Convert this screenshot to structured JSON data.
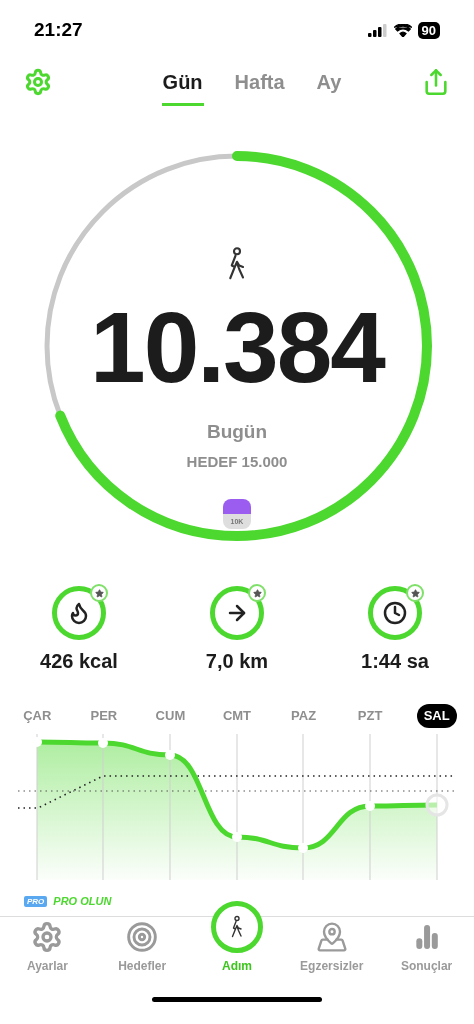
{
  "status_bar": {
    "time": "21:27",
    "battery": "90"
  },
  "tabs": [
    {
      "label": "Gün",
      "selected": true
    },
    {
      "label": "Hafta",
      "selected": false
    },
    {
      "label": "Ay",
      "selected": false
    }
  ],
  "ring": {
    "level": 0.69,
    "steps": "10.384",
    "day": "Bugün",
    "goal": "HEDEF 15.000",
    "badge": "10K"
  },
  "stats": [
    {
      "kind": "calories",
      "value": "426 kcal"
    },
    {
      "kind": "distance",
      "value": "7,0 km"
    },
    {
      "kind": "duration",
      "value": "1:44 sa"
    }
  ],
  "chart": {
    "days": [
      {
        "label": "ÇAR",
        "selected": false
      },
      {
        "label": "PER",
        "selected": false
      },
      {
        "label": "CUM",
        "selected": false
      },
      {
        "label": "CMT",
        "selected": false
      },
      {
        "label": "PAZ",
        "selected": false
      },
      {
        "label": "PZT",
        "selected": false
      },
      {
        "label": "SAL",
        "selected": true
      }
    ]
  },
  "promo": {
    "badge": "PRO",
    "text": "PRO OLUN"
  },
  "bottom_nav": [
    {
      "kind": "settings",
      "label": "Ayarlar",
      "selected": false
    },
    {
      "kind": "goals",
      "label": "Hedefler",
      "selected": false
    },
    {
      "kind": "steps",
      "label": "Adım",
      "selected": true
    },
    {
      "kind": "workouts",
      "label": "Egzersizler",
      "selected": false
    },
    {
      "kind": "results",
      "label": "Sonuçlar",
      "selected": false
    }
  ]
}
